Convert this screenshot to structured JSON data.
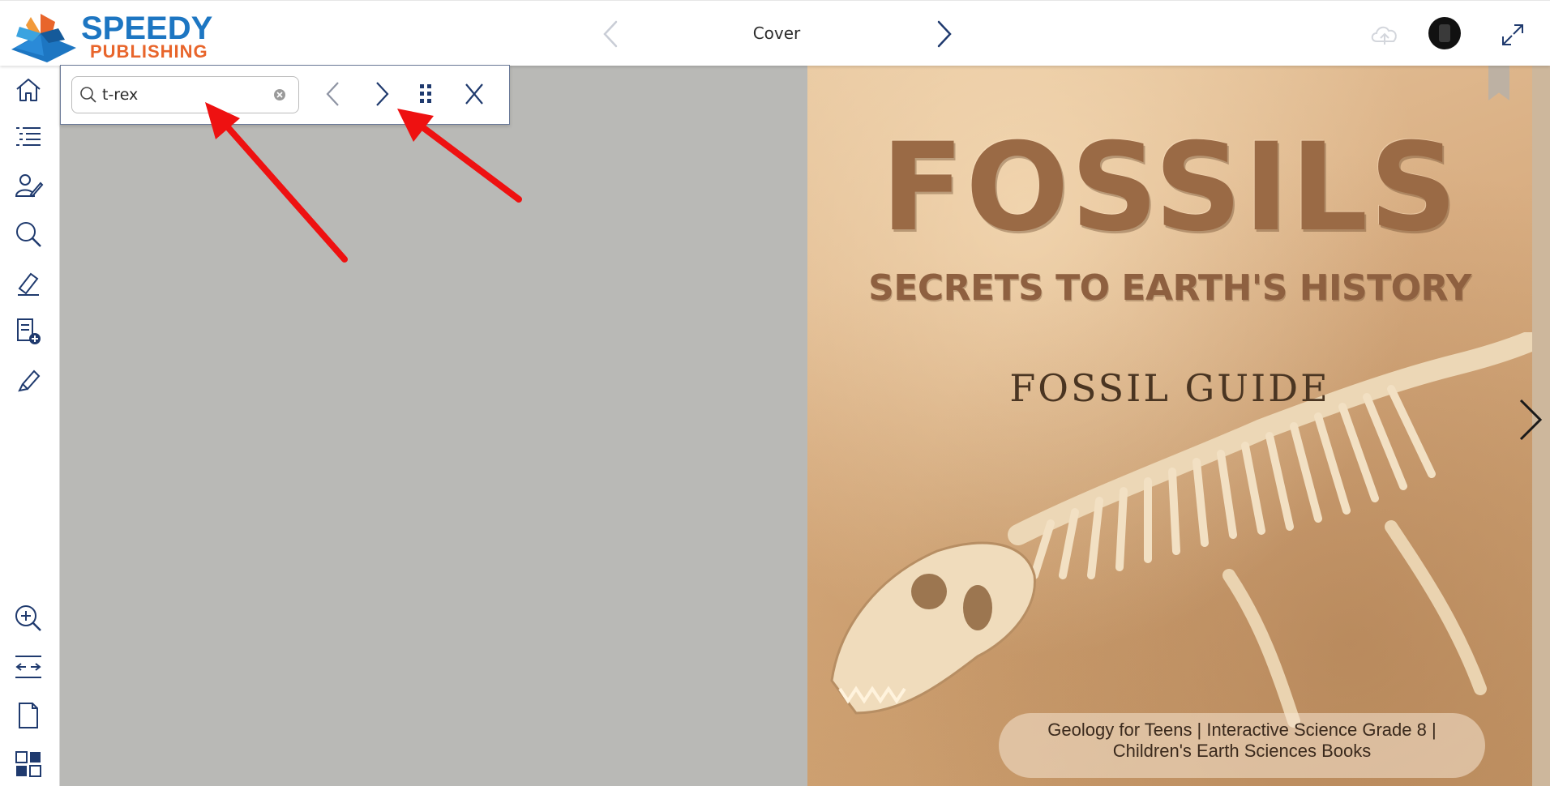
{
  "header": {
    "logo": {
      "word1": "SPEEDY",
      "word2": "PUBLISHING"
    },
    "page_title": "Cover",
    "icons": {
      "prev": "chevron-left-icon",
      "next": "chevron-right-icon",
      "cloud": "cloud-upload-icon",
      "avatar": "user-avatar",
      "fullscreen": "expand-icon"
    }
  },
  "sidebar": {
    "top_items": [
      "home-icon",
      "table-of-contents-icon",
      "profile-edit-icon",
      "search-icon",
      "annotate-pen-icon",
      "add-note-icon",
      "highlighter-icon"
    ],
    "bottom_items": [
      "zoom-in-icon",
      "fit-width-icon",
      "single-page-icon",
      "thumbnails-icon"
    ]
  },
  "search": {
    "query": "t-rex",
    "icons": {
      "magnifier": "search-icon",
      "clear": "clear-circle-icon",
      "prev": "previous-result-icon",
      "next": "next-result-icon",
      "grid": "results-grid-icon",
      "close": "close-icon"
    }
  },
  "book": {
    "title": "FOSSILS",
    "subtitle": "SECRETS TO EARTH'S HISTORY",
    "guide": "FOSSIL GUIDE",
    "tagline_line1": "Geology for Teens | Interactive Science Grade 8 |",
    "tagline_line2": "Children's Earth Sciences Books"
  },
  "colors": {
    "accent_navy": "#1f3a6e",
    "logo_blue": "#1d76c2",
    "logo_orange": "#e8652b",
    "canvas_gray": "#b9b9b6",
    "annotation_red": "#ee1111"
  }
}
